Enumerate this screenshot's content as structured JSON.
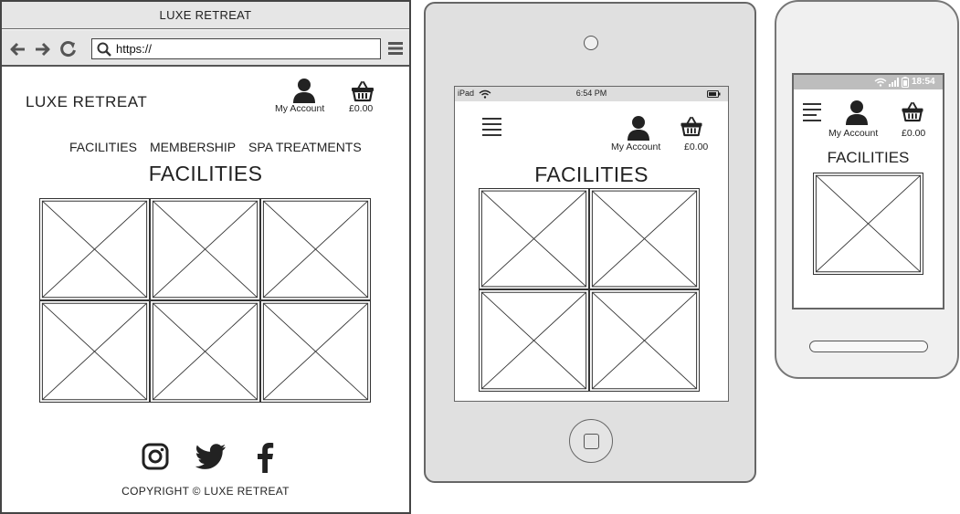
{
  "desktop": {
    "window_title": "LUXE RETREAT",
    "url": "https://",
    "logo": "LUXE RETREAT",
    "account_label": "My Account",
    "basket_total": "£0.00",
    "nav": [
      "FACILITIES",
      "MEMBERSHIP",
      "SPA TREATMENTS"
    ],
    "heading": "FACILITIES",
    "footer_social_icons": [
      "instagram-icon",
      "twitter-icon",
      "facebook-icon"
    ],
    "copyright": "COPYRIGHT © LUXE RETREAT"
  },
  "tablet": {
    "status_device": "iPad",
    "status_time": "6:54 PM",
    "account_label": "My Account",
    "basket_total": "£0.00",
    "heading": "FACILITIES"
  },
  "phone": {
    "status_time": "18:54",
    "account_label": "My Account",
    "basket_total": "£0.00",
    "heading": "FACILITIES"
  },
  "colors": {
    "chrome_gray": "#e6e6e6",
    "device_gray": "#e0e0e0",
    "line": "#333333"
  }
}
